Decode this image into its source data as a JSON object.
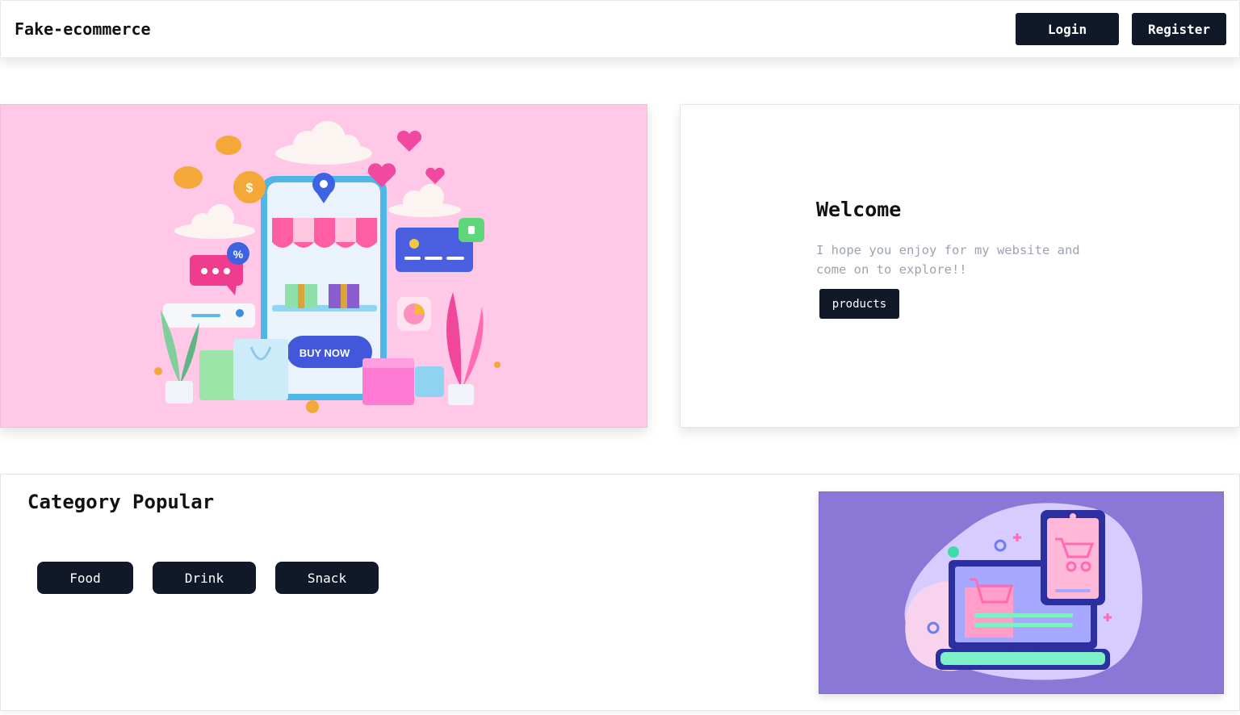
{
  "navbar": {
    "brand": "Fake-ecommerce",
    "login_label": "Login",
    "register_label": "Register"
  },
  "hero": {
    "illustration_button": "BUY NOW",
    "welcome_title": "Welcome",
    "welcome_text": "I hope you enjoy for my website and come on to explore!!",
    "products_label": "products"
  },
  "category": {
    "title": "Category Popular",
    "items": [
      {
        "label": "Food"
      },
      {
        "label": "Drink"
      },
      {
        "label": "Snack"
      }
    ]
  },
  "colors": {
    "dark_button": "#111827",
    "hero_bg": "#ffc8e6",
    "category_img_bg": "#8b78d6",
    "muted_text": "#9ca3af"
  }
}
